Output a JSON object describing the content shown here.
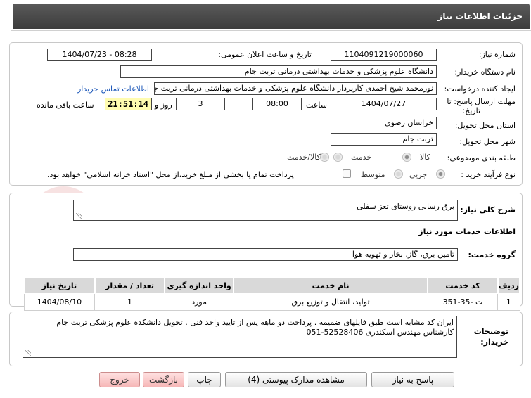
{
  "header": {
    "title": "جزئیات اطلاعات نیاز"
  },
  "form": {
    "need_number_label": "شماره نیاز:",
    "need_number": "1104091219000060",
    "announce_label": "تاریخ و ساعت اعلان عمومی:",
    "announce_value": "1404/07/23 - 08:28",
    "buyer_org_label": "نام دستگاه خریدار:",
    "buyer_org": "دانشگاه علوم پزشکی و خدمات بهداشتی  درمانی تربت جام",
    "requester_label": "ایجاد کننده درخواست:",
    "requester": "نورمحمد شیخ احمدی کارپرداز دانشگاه علوم پزشکی و خدمات بهداشتی  درمانی تربت جام",
    "contact_link": "اطلاعات تماس خریدار",
    "deadline_label_1": "مهلت ارسال پاسخ: تا",
    "deadline_label_2": "تاریخ:",
    "deadline_date": "1404/07/27",
    "time_label": "ساعت",
    "deadline_time": "08:00",
    "days_value": "3",
    "days_label": "روز و",
    "remaining_time": "21:51:14",
    "remaining_label": "ساعت باقی مانده",
    "province_label": "استان محل تحویل:",
    "province": "خراسان رضوی",
    "city_label": "شهر محل تحویل:",
    "city": "تربت جام",
    "category_label": "طبقه بندی موضوعی:",
    "category_options": [
      "کالا",
      "خدمت",
      "کالا/خدمت"
    ],
    "process_label": "نوع فرآیند خرید :",
    "process_options": [
      "جزیی",
      "متوسط"
    ],
    "payment_note": "پرداخت تمام یا بخشی از مبلغ خرید،از محل \"اسناد خزانه اسلامی\" خواهد بود."
  },
  "summary": {
    "label": "شرح کلی نیاز:",
    "value": "برق رسانی روستای تغز سفلی",
    "services_title": "اطلاعات خدمات مورد نیاز",
    "group_label": "گروه خدمت:",
    "group_value": "تامین برق، گاز، بخار و تهویه هوا"
  },
  "table": {
    "headers": [
      "ردیف",
      "کد خدمت",
      "نام خدمت",
      "واحد اندازه گیری",
      "تعداد / مقدار",
      "تاریخ نیاز"
    ],
    "rows": [
      [
        "1",
        "ت -35-351",
        "تولید، انتقال و توزیع برق",
        "مورد",
        "1",
        "1404/08/10"
      ]
    ]
  },
  "notes": {
    "label_1": "توضیحات",
    "label_2": "خریدار:",
    "line_1": "ایران کد مشابه است طبق فایلهای ضمیمه . پرداخت دو ماهه پس از تایید واحد فنی . تحویل دانشکده علوم پزشکی تربت جام",
    "line_2": "کارشناس مهندس اسکندری 52528406-051"
  },
  "buttons": {
    "reply": "پاسخ به نیاز",
    "attachments": "مشاهده مدارک پیوستی (4)",
    "print": "چاپ",
    "back": "بازگشت",
    "exit": "خروج"
  },
  "watermark": {
    "text": "AriaTender.net"
  }
}
